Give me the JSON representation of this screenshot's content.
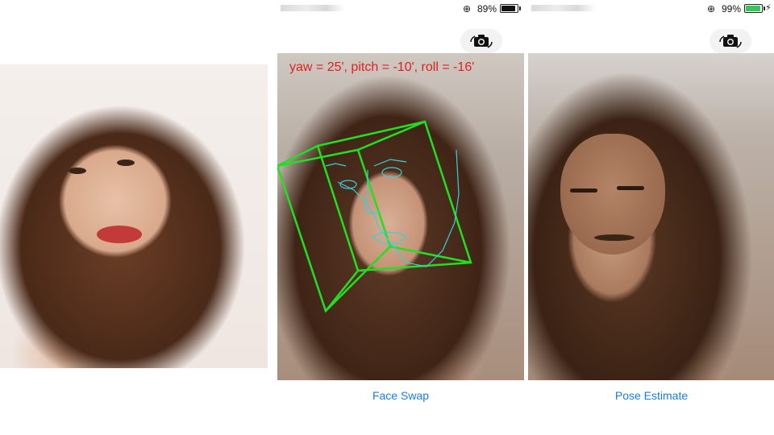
{
  "screen_a": {
    "status": {
      "battery_text": "89%",
      "battery_level": 0.89,
      "battery_color": "#111111"
    },
    "pose_text": "yaw = 25', pitch = -10', roll = -16'",
    "label": "Face Swap"
  },
  "screen_b": {
    "status": {
      "battery_text": "99%",
      "battery_level": 0.99,
      "battery_color": "#35c759",
      "charging": true
    },
    "label": "Pose Estimate"
  },
  "colors": {
    "accent": "#1a7de0",
    "pose_text": "#e02020",
    "cube": "#21e021",
    "landmarks": "#3ad0d8"
  },
  "icons": [
    "orientation-lock-icon",
    "battery-icon",
    "charging-bolt-icon",
    "camera-switch-icon"
  ]
}
